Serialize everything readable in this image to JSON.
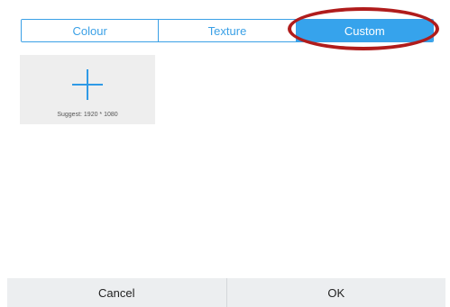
{
  "tabs": [
    {
      "label": "Colour",
      "active": false
    },
    {
      "label": "Texture",
      "active": false
    },
    {
      "label": "Custom",
      "active": true
    }
  ],
  "highlight": {
    "target": "Custom",
    "color": "#b01c1c"
  },
  "custom": {
    "add_icon": "plus-icon",
    "suggest_text": "Suggest: 1920 * 1080"
  },
  "actions": {
    "cancel_label": "Cancel",
    "ok_label": "OK"
  },
  "colors": {
    "accent": "#36a3ec",
    "tile_background": "#eeeeee",
    "action_bar": "#eceef0"
  }
}
